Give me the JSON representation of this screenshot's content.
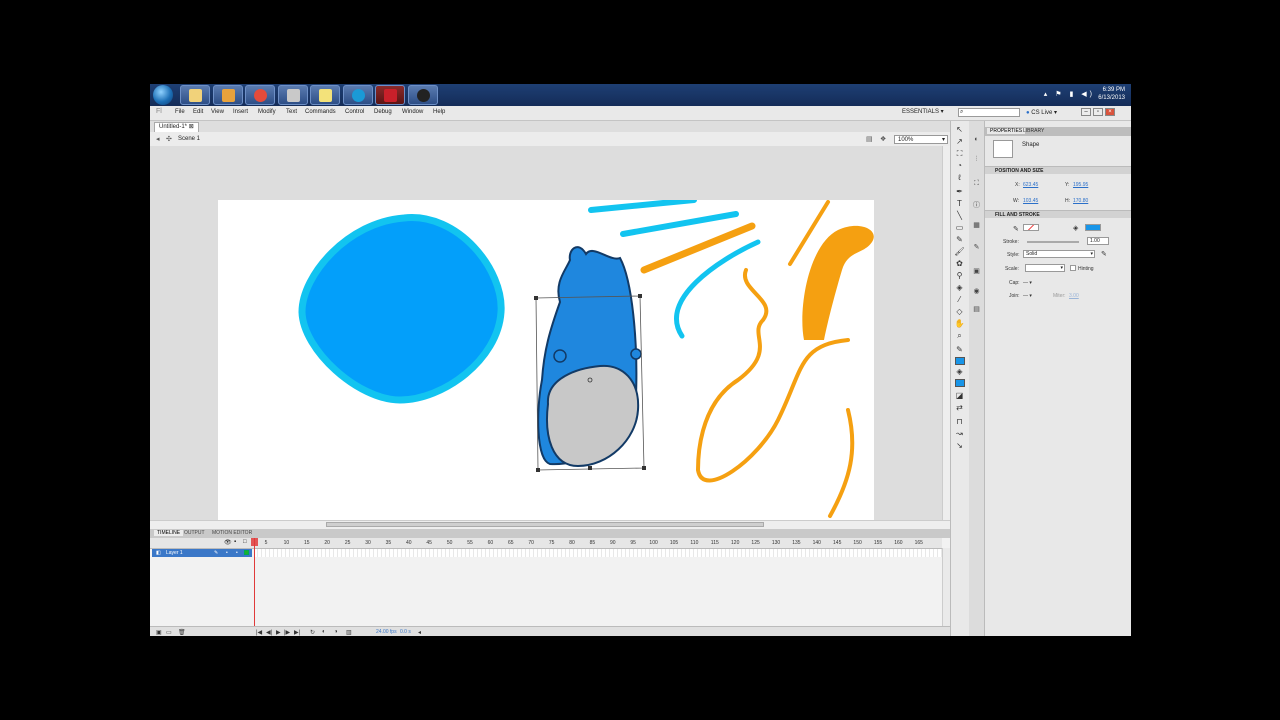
{
  "taskbar": {
    "apps": [
      {
        "name": "explorer",
        "color": "#f1d27a"
      },
      {
        "name": "media-player",
        "color": "#e8a23c"
      },
      {
        "name": "chrome",
        "color": "#e44b3b"
      },
      {
        "name": "app4",
        "color": "#c9c9c9"
      },
      {
        "name": "app5",
        "color": "#f3e27a"
      },
      {
        "name": "skype",
        "color": "#1a9ad6"
      },
      {
        "name": "flash",
        "color": "#c8202a"
      },
      {
        "name": "app8",
        "color": "#222222"
      }
    ],
    "time": "6:39 PM",
    "date": "6/13/2013"
  },
  "menu": {
    "items": [
      "File",
      "Edit",
      "View",
      "Insert",
      "Modify",
      "Text",
      "Commands",
      "Control",
      "Debug",
      "Window",
      "Help"
    ],
    "workspace": "ESSENTIALS",
    "search_placeholder": "",
    "cs_live": "CS Live"
  },
  "document": {
    "tab": "Untitled-1*",
    "scene": "Scene 1",
    "zoom": "100%"
  },
  "timeline": {
    "tabs": [
      "TIMELINE",
      "OUTPUT",
      "MOTION EDITOR"
    ],
    "layer_name": "Layer 1",
    "ruler": [
      "5",
      "10",
      "15",
      "20",
      "25",
      "30",
      "35",
      "40",
      "45",
      "50",
      "55",
      "60",
      "65",
      "70",
      "75",
      "80",
      "85",
      "90",
      "95",
      "100",
      "105",
      "110",
      "115",
      "120",
      "125",
      "130",
      "135",
      "140",
      "145",
      "150",
      "155",
      "160",
      "165"
    ],
    "fps": "24.00 fps",
    "time": "0.0 s"
  },
  "properties": {
    "tabs": [
      "PROPERTIES",
      "LIBRARY"
    ],
    "object_type": "Shape",
    "position_section": "POSITION AND SIZE",
    "x_label": "X:",
    "x_value": "623.45",
    "y_label": "Y:",
    "y_value": "195.95",
    "w_label": "W:",
    "w_value": "103.45",
    "h_label": "H:",
    "h_value": "170.80",
    "fill_section": "FILL AND STROKE",
    "stroke_label": "Stroke:",
    "stroke_value": "1.00",
    "style_label": "Style:",
    "style_value": "Solid",
    "scale_label": "Scale:",
    "hinting_label": "Hinting",
    "cap_label": "Cap:",
    "join_label": "Join:",
    "miter_label": "Miter:",
    "miter_value": "3.00",
    "fill_color": "#1895e8"
  },
  "colors": {
    "cyan": "#12c4f0",
    "blue": "#039ffa",
    "orange": "#f5a011",
    "character_blue": "#1f87de"
  }
}
